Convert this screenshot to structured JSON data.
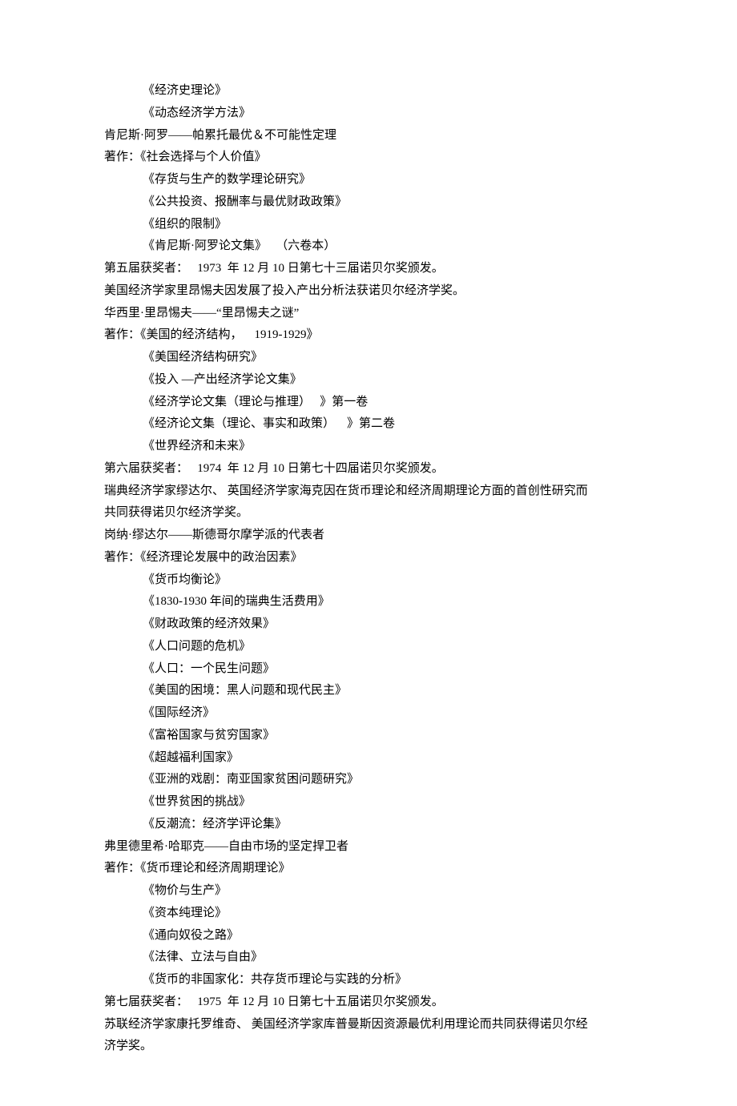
{
  "lines": [
    {
      "cls": "indent1",
      "text": "《经济史理论》"
    },
    {
      "cls": "indent1",
      "text": "《动态经济学方法》"
    },
    {
      "cls": "",
      "text": "肯尼斯·阿罗——帕累托最优＆不可能性定理"
    },
    {
      "cls": "",
      "text": "著作：《社会选择与个人价值》"
    },
    {
      "cls": "indent1",
      "text": "《存货与生产的数学理论研究》"
    },
    {
      "cls": "indent1",
      "text": "《公共投资、报酬率与最优财政政策》"
    },
    {
      "cls": "indent1",
      "text": "《组织的限制》"
    },
    {
      "cls": "indent1",
      "text": "《肯尼斯·阿罗论文集》   （六卷本）"
    },
    {
      "cls": "",
      "text": "第五届获奖者：   1973  年 12 月 10 日第七十三届诺贝尔奖颁发。"
    },
    {
      "cls": "",
      "text": "美国经济学家里昂惕夫因发展了投入产出分析法获诺贝尔经济学奖。"
    },
    {
      "cls": "",
      "text": "华西里·里昂惕夫——“里昂惕夫之谜”"
    },
    {
      "cls": "",
      "text": "著作：《美国的经济结构，    1919-1929》"
    },
    {
      "cls": "indent1",
      "text": "《美国经济结构研究》"
    },
    {
      "cls": "indent1",
      "text": "《投入 —产出经济学论文集》"
    },
    {
      "cls": "indent1",
      "text": "《经济学论文集（理论与推理）   》第一卷"
    },
    {
      "cls": "indent1",
      "text": "《经济论文集（理论、事实和政策）    》第二卷"
    },
    {
      "cls": "indent1",
      "text": "《世界经济和未来》"
    },
    {
      "cls": "",
      "text": "第六届获奖者：   1974  年 12 月 10 日第七十四届诺贝尔奖颁发。"
    },
    {
      "cls": "",
      "text": "瑞典经济学家缪达尔、 英国经济学家海克因在货币理论和经济周期理论方面的首创性研究而"
    },
    {
      "cls": "",
      "text": "共同获得诺贝尔经济学奖。"
    },
    {
      "cls": "",
      "text": "岗纳·缪达尔——斯德哥尔摩学派的代表者"
    },
    {
      "cls": "",
      "text": "著作：《经济理论发展中的政治因素》"
    },
    {
      "cls": "indent1",
      "text": "《货币均衡论》"
    },
    {
      "cls": "indent1",
      "text": "《1830-1930 年间的瑞典生活费用》"
    },
    {
      "cls": "indent1",
      "text": "《财政政策的经济效果》"
    },
    {
      "cls": "indent1",
      "text": "《人口问题的危机》"
    },
    {
      "cls": "indent1",
      "text": "《人口：一个民生问题》"
    },
    {
      "cls": "indent1",
      "text": "《美国的困境：黑人问题和现代民主》"
    },
    {
      "cls": "indent1",
      "text": "《国际经济》"
    },
    {
      "cls": "indent1",
      "text": "《富裕国家与贫穷国家》"
    },
    {
      "cls": "indent1",
      "text": "《超越福利国家》"
    },
    {
      "cls": "indent1",
      "text": "《亚洲的戏剧：南亚国家贫困问题研究》"
    },
    {
      "cls": "indent1",
      "text": "《世界贫困的挑战》"
    },
    {
      "cls": "indent1",
      "text": "《反潮流：经济学评论集》"
    },
    {
      "cls": "",
      "text": "弗里德里希·哈耶克——自由市场的坚定捍卫者"
    },
    {
      "cls": "",
      "text": "著作：《货币理论和经济周期理论》"
    },
    {
      "cls": "indent1",
      "text": "《物价与生产》"
    },
    {
      "cls": "indent1",
      "text": "《资本纯理论》"
    },
    {
      "cls": "indent1",
      "text": "《通向奴役之路》"
    },
    {
      "cls": "indent1",
      "text": "《法律、立法与自由》"
    },
    {
      "cls": "indent1",
      "text": "《货币的非国家化：共存货币理论与实践的分析》"
    },
    {
      "cls": "",
      "text": "第七届获奖者：   1975  年 12 月 10 日第七十五届诺贝尔奖颁发。"
    },
    {
      "cls": "",
      "text": "苏联经济学家康托罗维奇、 美国经济学家库普曼斯因资源最优利用理论而共同获得诺贝尔经"
    },
    {
      "cls": "",
      "text": "济学奖。"
    }
  ]
}
